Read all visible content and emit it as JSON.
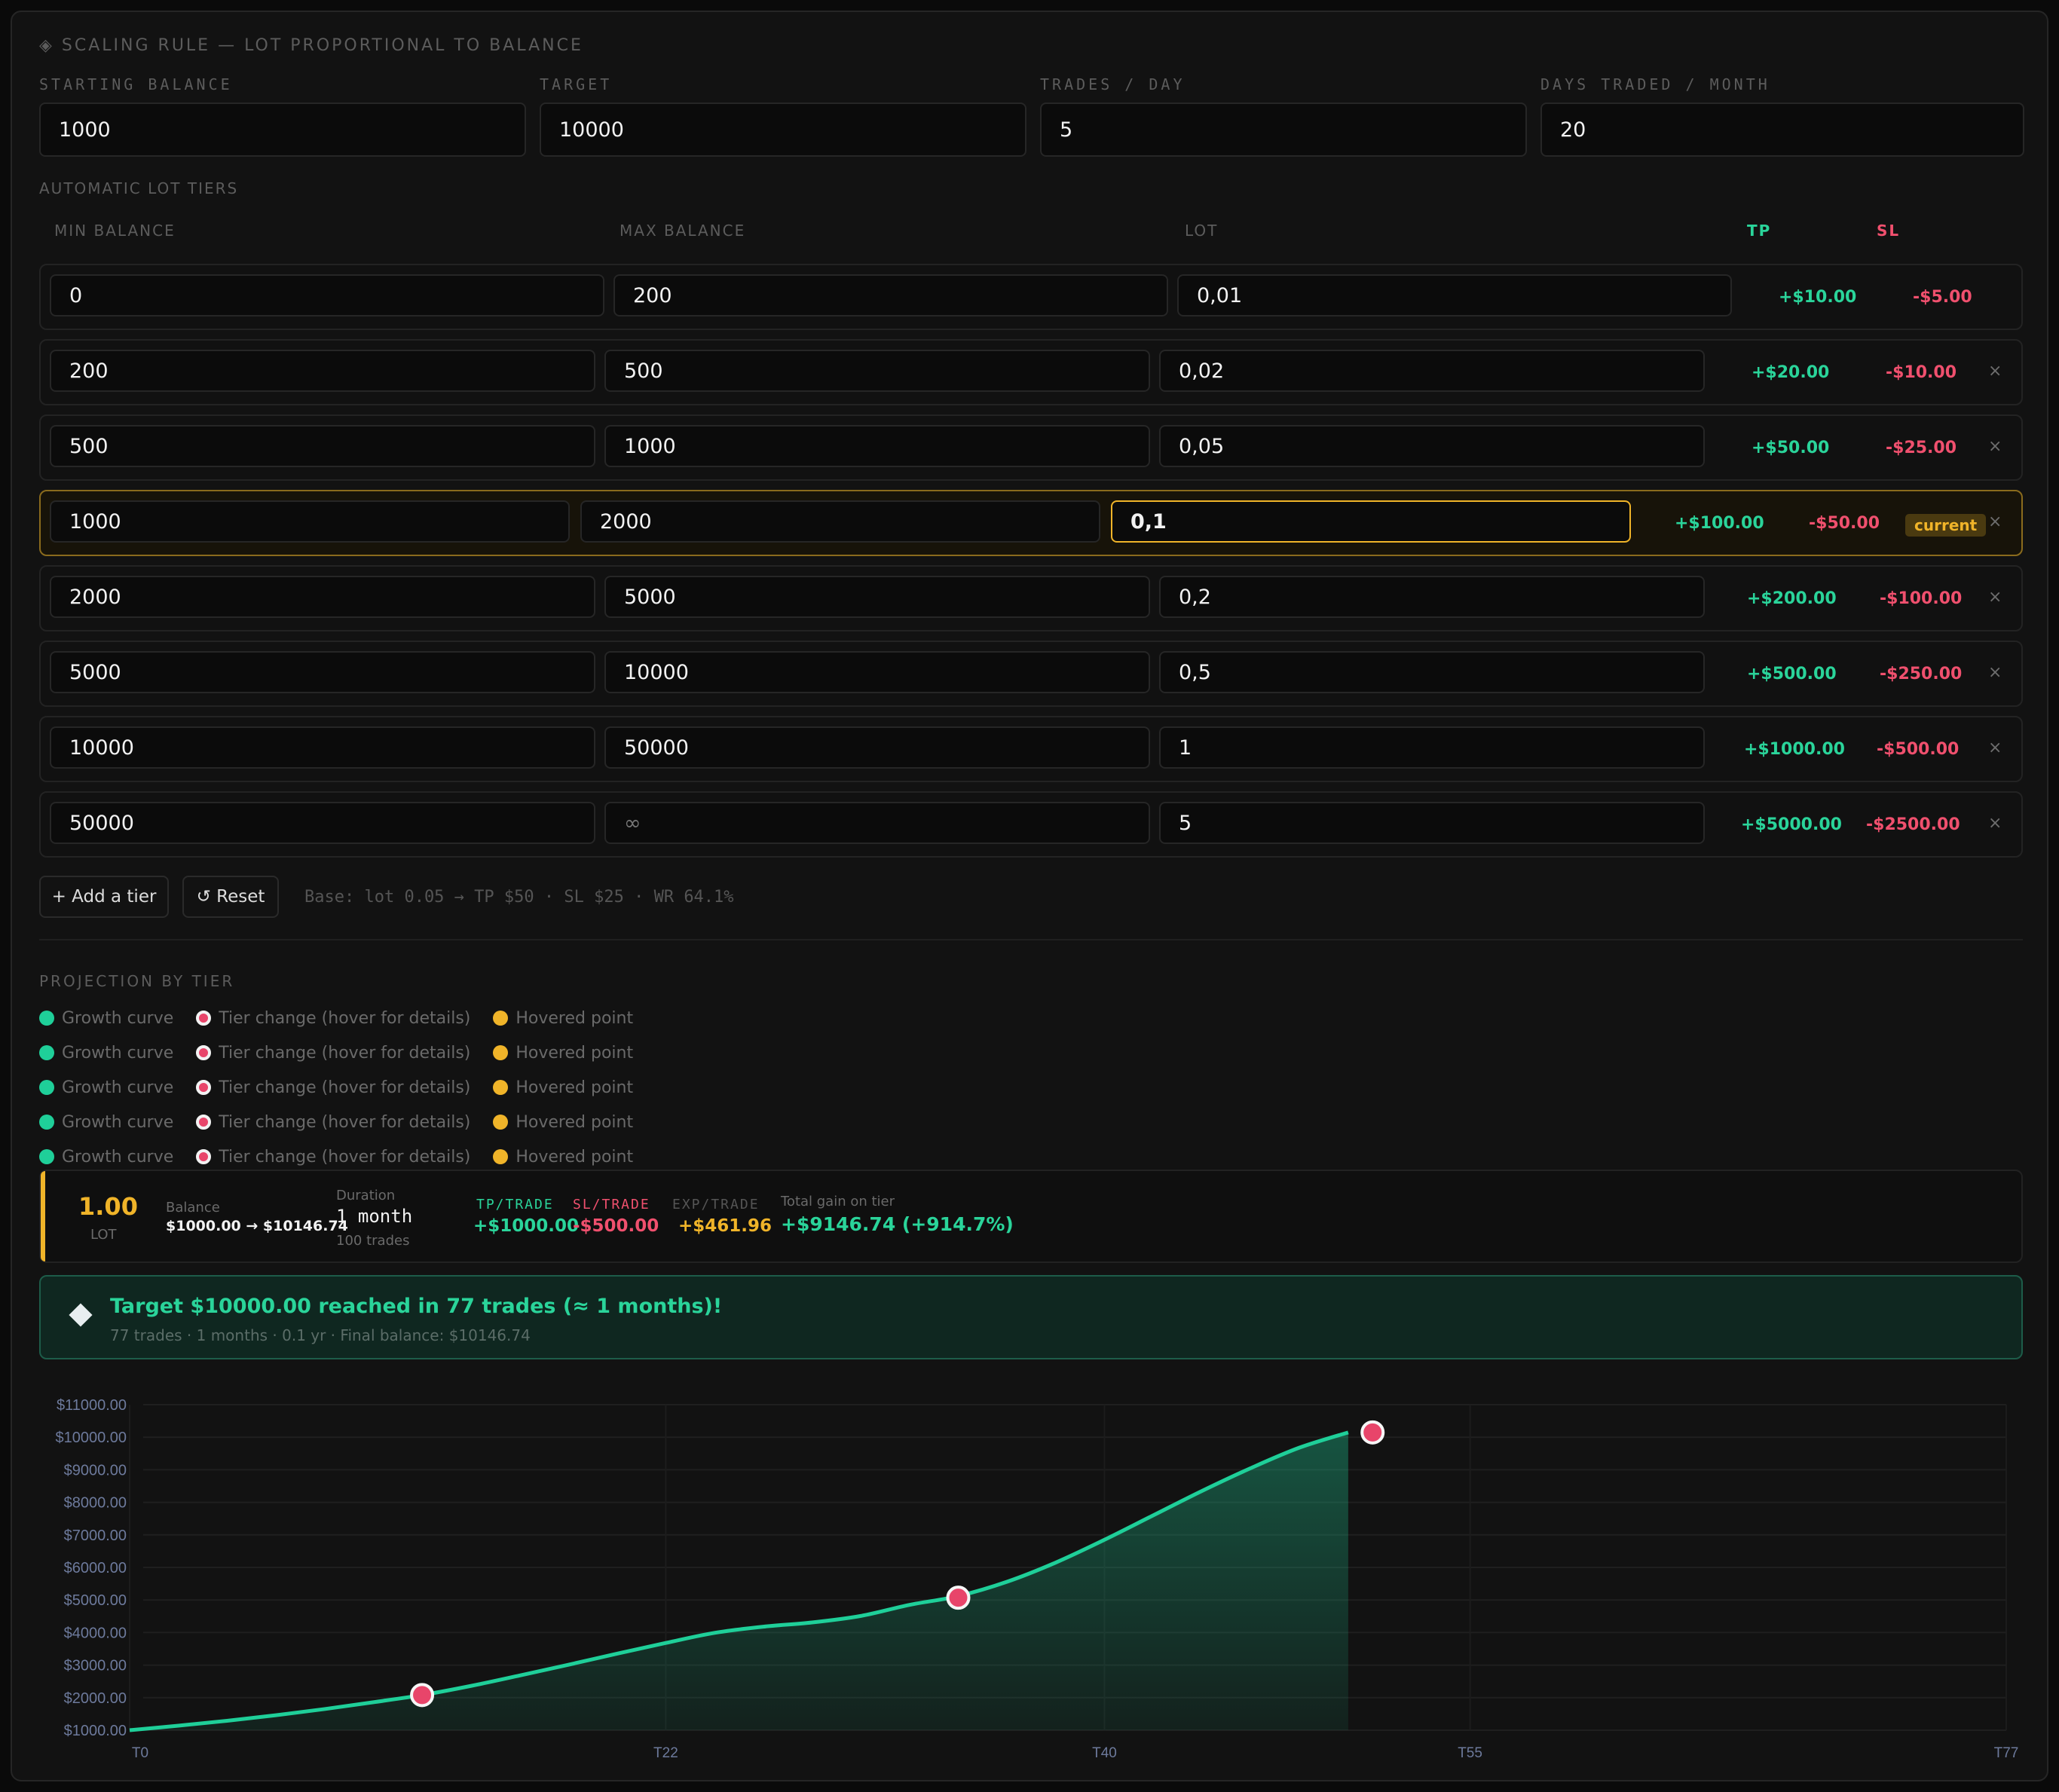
{
  "section_title": "◈ SCALING RULE — LOT PROPORTIONAL TO BALANCE",
  "params": [
    {
      "label": "STARTING BALANCE",
      "value": "1000"
    },
    {
      "label": "TARGET",
      "value": "10000"
    },
    {
      "label": "TRADES / DAY",
      "value": "5"
    },
    {
      "label": "DAYS TRADED / MONTH",
      "value": "20"
    }
  ],
  "tiers_title": "AUTOMATIC LOT TIERS",
  "tier_headers": {
    "min": "MIN BALANCE",
    "max": "MAX BALANCE",
    "lot": "LOT",
    "tp": "TP",
    "sl": "SL"
  },
  "tiers": [
    {
      "min": "0",
      "max": "200",
      "lot": "0,01",
      "tp": "+$10.00",
      "sl": "-$5.00"
    },
    {
      "min": "200",
      "max": "500",
      "lot": "0,02",
      "tp": "+$20.00",
      "sl": "-$10.00"
    },
    {
      "min": "500",
      "max": "1000",
      "lot": "0,05",
      "tp": "+$50.00",
      "sl": "-$25.00"
    },
    {
      "min": "1000",
      "max": "2000",
      "lot": "0,1",
      "tp": "+$100.00",
      "sl": "-$50.00",
      "badge": "current"
    },
    {
      "min": "2000",
      "max": "5000",
      "lot": "0,2",
      "tp": "+$200.00",
      "sl": "-$100.00"
    },
    {
      "min": "5000",
      "max": "10000",
      "lot": "0,5",
      "tp": "+$500.00",
      "sl": "-$250.00"
    },
    {
      "min": "10000",
      "max": "50000",
      "lot": "1",
      "tp": "+$1000.00",
      "sl": "-$500.00"
    },
    {
      "min": "50000",
      "max": "∞",
      "lot": "5",
      "tp": "+$5000.00",
      "sl": "-$2500.00"
    }
  ],
  "delete_glyph": "×",
  "add_tier_label": "+ Add a tier",
  "reset_label": "↺ Reset",
  "base_info": "Base: lot 0.05 → TP $50 · SL $25 · WR 64.1%",
  "projection_title": "PROJECTION BY TIER",
  "legend": [
    "Growth curve",
    "Tier change (hover for details)",
    "Hovered point"
  ],
  "colors": {
    "growth": "#1fcf99",
    "tier_change": "#e8456a",
    "hovered": "#f0b429",
    "accent": "#f0b429"
  },
  "detail": {
    "lot_value": "1.00",
    "lot_label": "LOT",
    "balance_label": "Balance",
    "balance_value": "$1000.00 → $10146.74",
    "duration_label": "Duration",
    "duration_value": "1 month",
    "duration_sub": "100 trades",
    "tp_label": "TP/TRADE",
    "tp_value": "+$1000.00",
    "sl_label": "SL/TRADE",
    "sl_value": "-$500.00",
    "exp_label": "EXP/TRADE",
    "exp_value": "+$461.96",
    "gain_label": "Total gain on tier",
    "gain_value": "+$9146.74 (+914.7%)"
  },
  "banner": {
    "icon": "diamond-icon",
    "title": "Target $10000.00 reached in 77 trades (≈ 1 months)!",
    "sub": "77 trades · 1 months · 0.1 yr · Final balance: $10146.74"
  },
  "chart_data": {
    "type": "area",
    "x": [
      0,
      2,
      4,
      6,
      8,
      10,
      12,
      14,
      16,
      18,
      20,
      22,
      24,
      26,
      28,
      30,
      32,
      34,
      36,
      38,
      40,
      42,
      44,
      46,
      48,
      50,
      52
    ],
    "y": [
      1000,
      1140,
      1290,
      1460,
      1650,
      1860,
      2080,
      2360,
      2680,
      3010,
      3350,
      3680,
      3990,
      4180,
      4310,
      4510,
      4850,
      5120,
      5560,
      6150,
      6850,
      7600,
      8350,
      9050,
      9680,
      10146.74,
      10146.74
    ],
    "markers": [
      {
        "x": 12,
        "y": 2080
      },
      {
        "x": 34,
        "y": 5070
      },
      {
        "x": 51,
        "y": 10146.74
      }
    ],
    "ylim": [
      1000,
      11000
    ],
    "xlim": [
      0,
      77
    ],
    "yticks": [
      "$1000.00",
      "$2000.00",
      "$3000.00",
      "$4000.00",
      "$5000.00",
      "$6000.00",
      "$7000.00",
      "$8000.00",
      "$9000.00",
      "$10000.00",
      "$11000.00"
    ],
    "xticks": [
      {
        "v": 0,
        "label": "T0"
      },
      {
        "v": 22,
        "label": "T22"
      },
      {
        "v": 40,
        "label": "T40"
      },
      {
        "v": 55,
        "label": "T55"
      },
      {
        "v": 77,
        "label": "T77"
      }
    ],
    "grid": true
  }
}
